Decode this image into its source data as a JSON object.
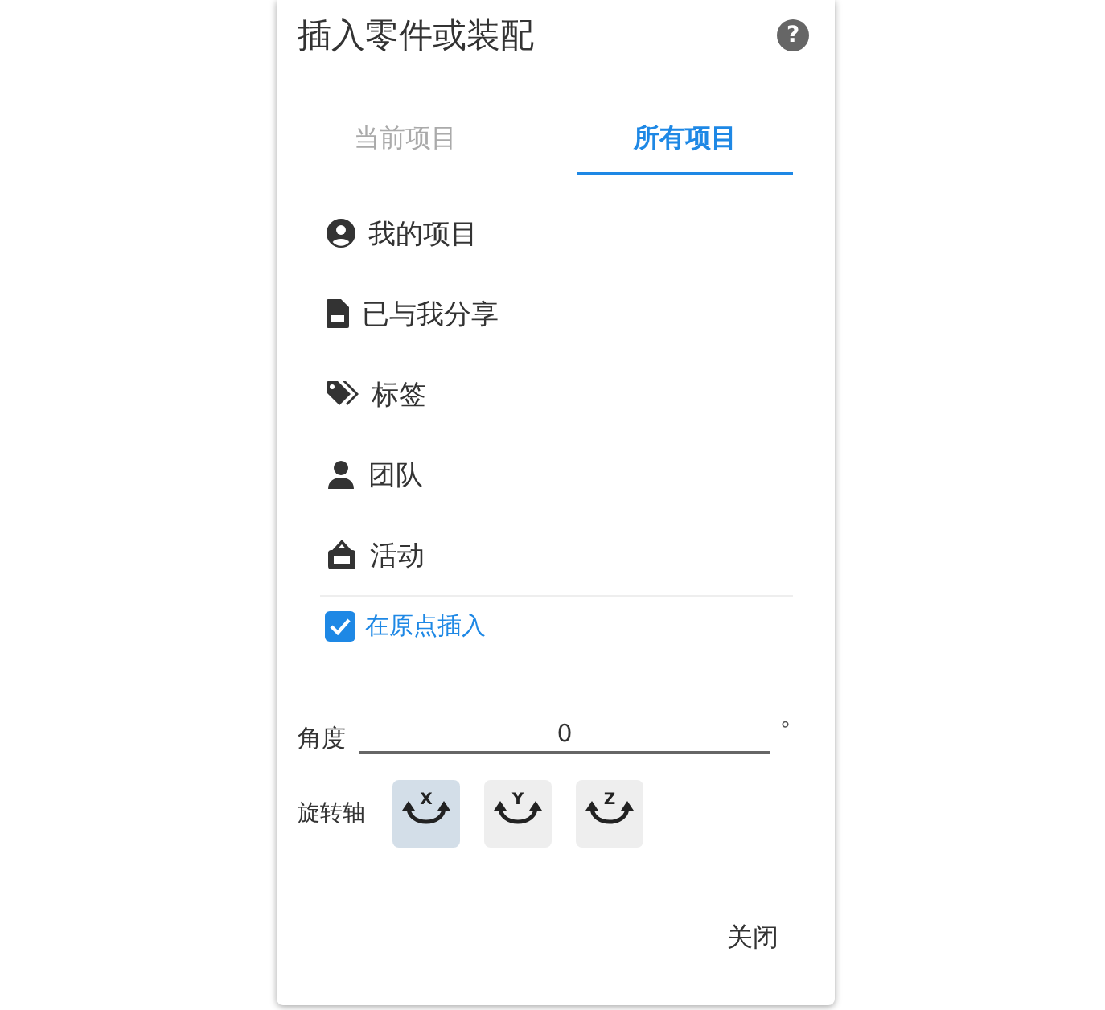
{
  "dialog": {
    "title": "插入零件或装配",
    "help": "?"
  },
  "tabs": [
    {
      "label": "当前项目",
      "selected": false
    },
    {
      "label": "所有项目",
      "selected": true
    }
  ],
  "nav_items": [
    {
      "label": "我的项目",
      "kind": "user"
    },
    {
      "label": "已与我分享",
      "kind": "file"
    },
    {
      "label": "标签",
      "kind": "tags"
    },
    {
      "label": "团队",
      "kind": "team"
    },
    {
      "label": "活动",
      "kind": "activity"
    }
  ],
  "insert_at_origin": {
    "label": "在原点插入",
    "checked": true
  },
  "angle": {
    "label": "角度",
    "value": "0",
    "unit": "°"
  },
  "rotation_axis": {
    "label": "旋转轴",
    "axes": [
      {
        "label": "X",
        "selected": true
      },
      {
        "label": "Y",
        "selected": false
      },
      {
        "label": "Z",
        "selected": false
      }
    ]
  },
  "close_button": "关闭"
}
